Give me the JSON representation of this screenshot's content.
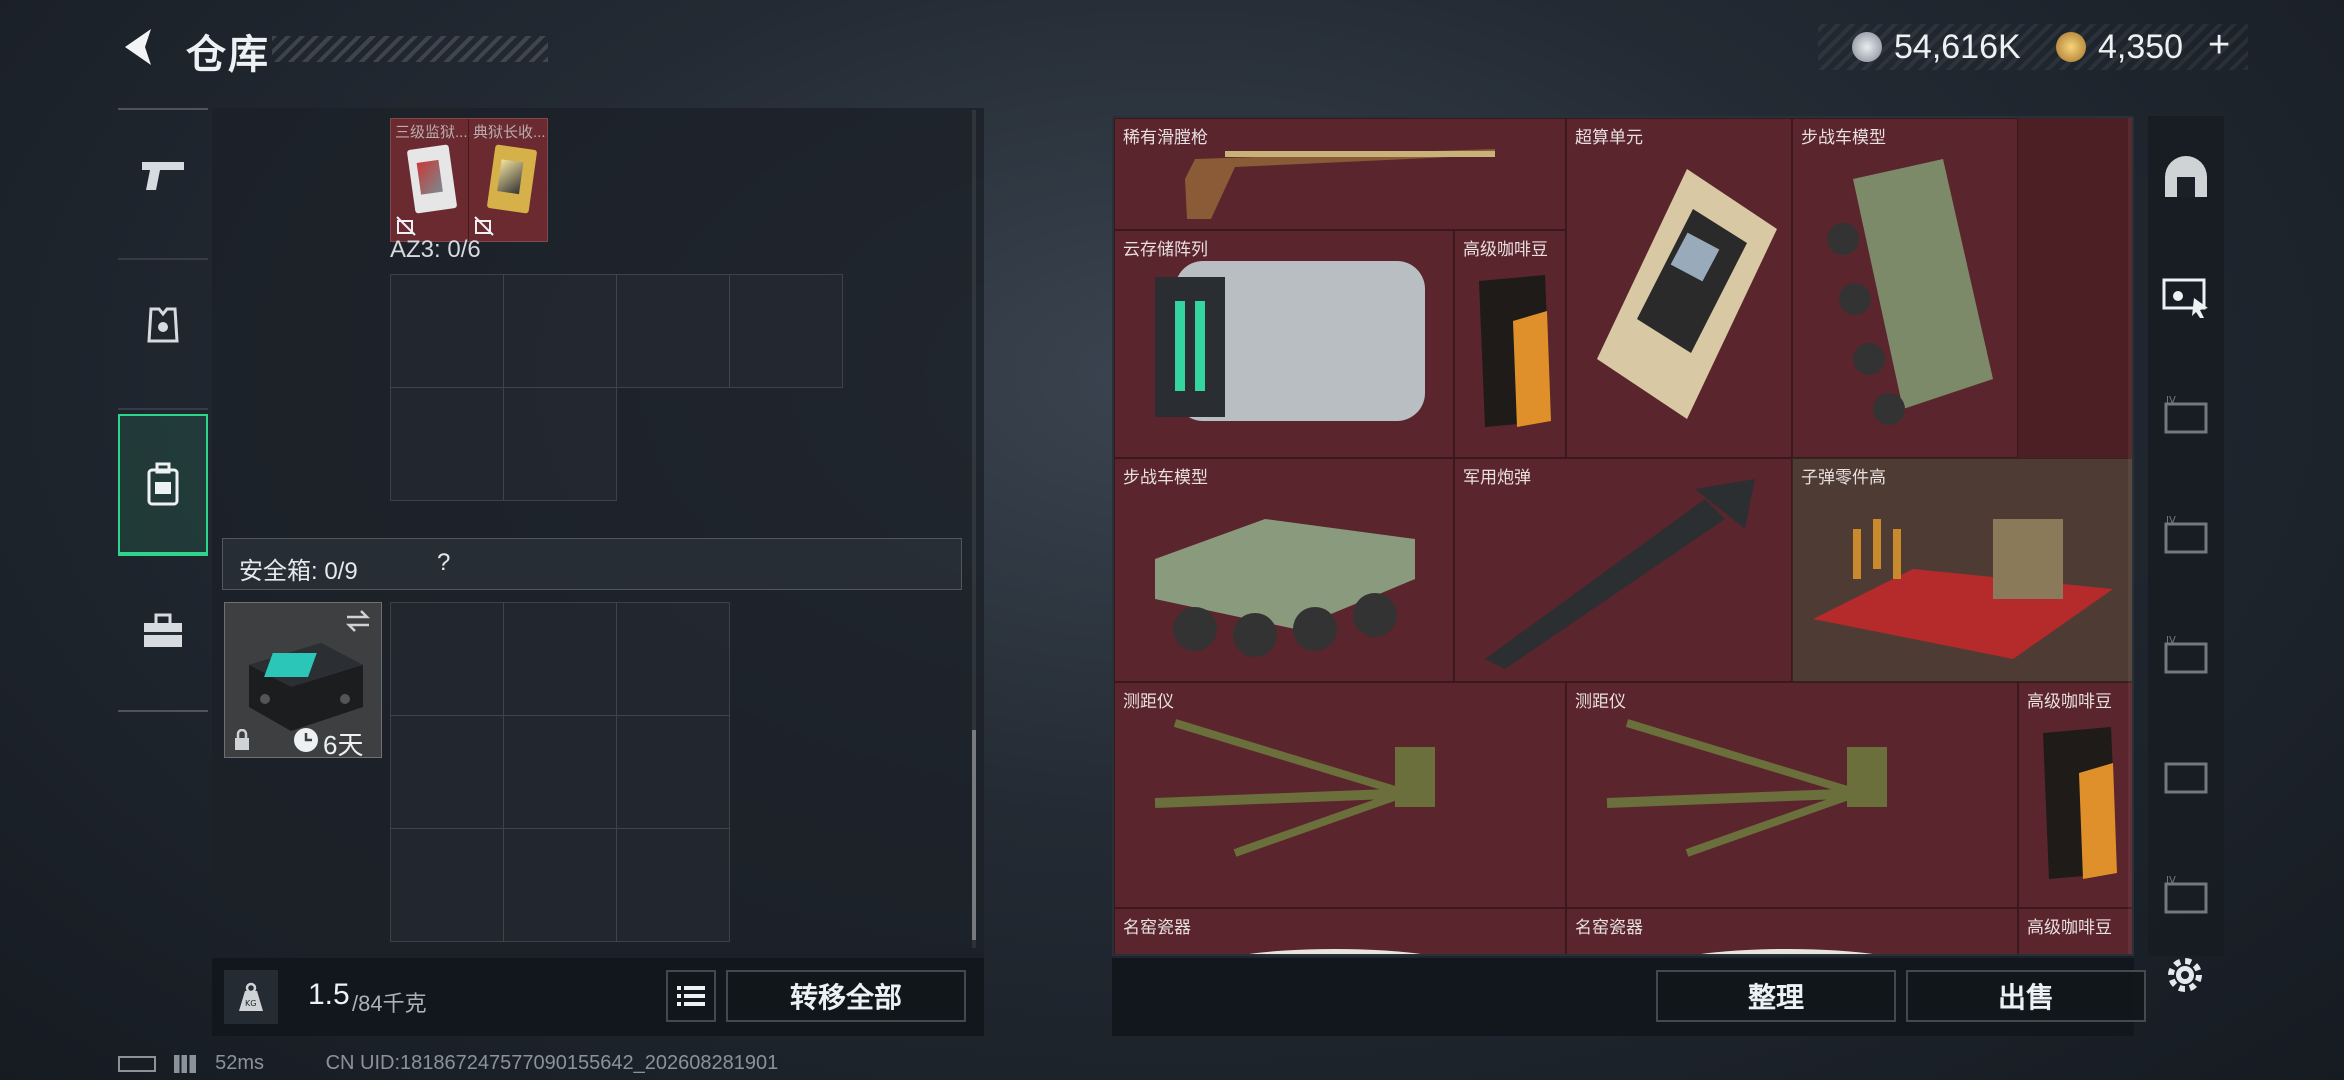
{
  "header": {
    "title": "仓库",
    "currency": {
      "silver": "54,616K",
      "gold": "4,350",
      "add_symbol": "+"
    }
  },
  "left_tabs": [
    {
      "name": "weapons",
      "icon": "pistol-icon"
    },
    {
      "name": "equipment",
      "icon": "armor-icon"
    },
    {
      "name": "backpack",
      "icon": "backpack-icon",
      "active": true
    },
    {
      "name": "kit",
      "icon": "toolbox-icon"
    }
  ],
  "containers": {
    "top_items": [
      {
        "label": "三级监狱..."
      },
      {
        "label": "典狱长收..."
      }
    ],
    "az3_label": "AZ3: 0/6",
    "safe_box_label": "安全箱: 0/9",
    "safe_box_help": "?",
    "safe_box_timer": "6天"
  },
  "bottom_left": {
    "weight_current": "1.5",
    "weight_max": "/84千克",
    "transfer_all": "转移全部",
    "weight_icon_text": "KG"
  },
  "items": [
    {
      "label": "稀有滑膛枪"
    },
    {
      "label": "超算单元"
    },
    {
      "label": "步战车模型"
    },
    {
      "label": "云存储阵列"
    },
    {
      "label": "高级咖啡豆"
    },
    {
      "label": "步战车模型"
    },
    {
      "label": "军用炮弹"
    },
    {
      "label": "子弹零件高"
    },
    {
      "label": "测距仪"
    },
    {
      "label": "测距仪"
    },
    {
      "label": "高级咖啡豆"
    },
    {
      "label": "名窑瓷器"
    },
    {
      "label": "名窑瓷器"
    },
    {
      "label": "高级咖啡豆"
    }
  ],
  "right_bottom": {
    "sort": "整理",
    "sell": "出售"
  },
  "right_tabs": [
    {
      "icon": "helmet-icon"
    },
    {
      "icon": "card-cursor-icon",
      "active": true
    },
    {
      "icon": "card-iv-icon-1"
    },
    {
      "icon": "card-iv-icon-2"
    },
    {
      "icon": "card-iv-icon-3"
    },
    {
      "icon": "card-iv-icon-4"
    },
    {
      "icon": "card-iv-icon-5"
    }
  ],
  "status": {
    "ping": "52ms",
    "uid": "CN UID:181867247577090155642_202608281901"
  },
  "colors": {
    "item_bg": "#5a252c",
    "gold_item_bg": "#4e3c34",
    "active_tab": "#2fd58a"
  }
}
